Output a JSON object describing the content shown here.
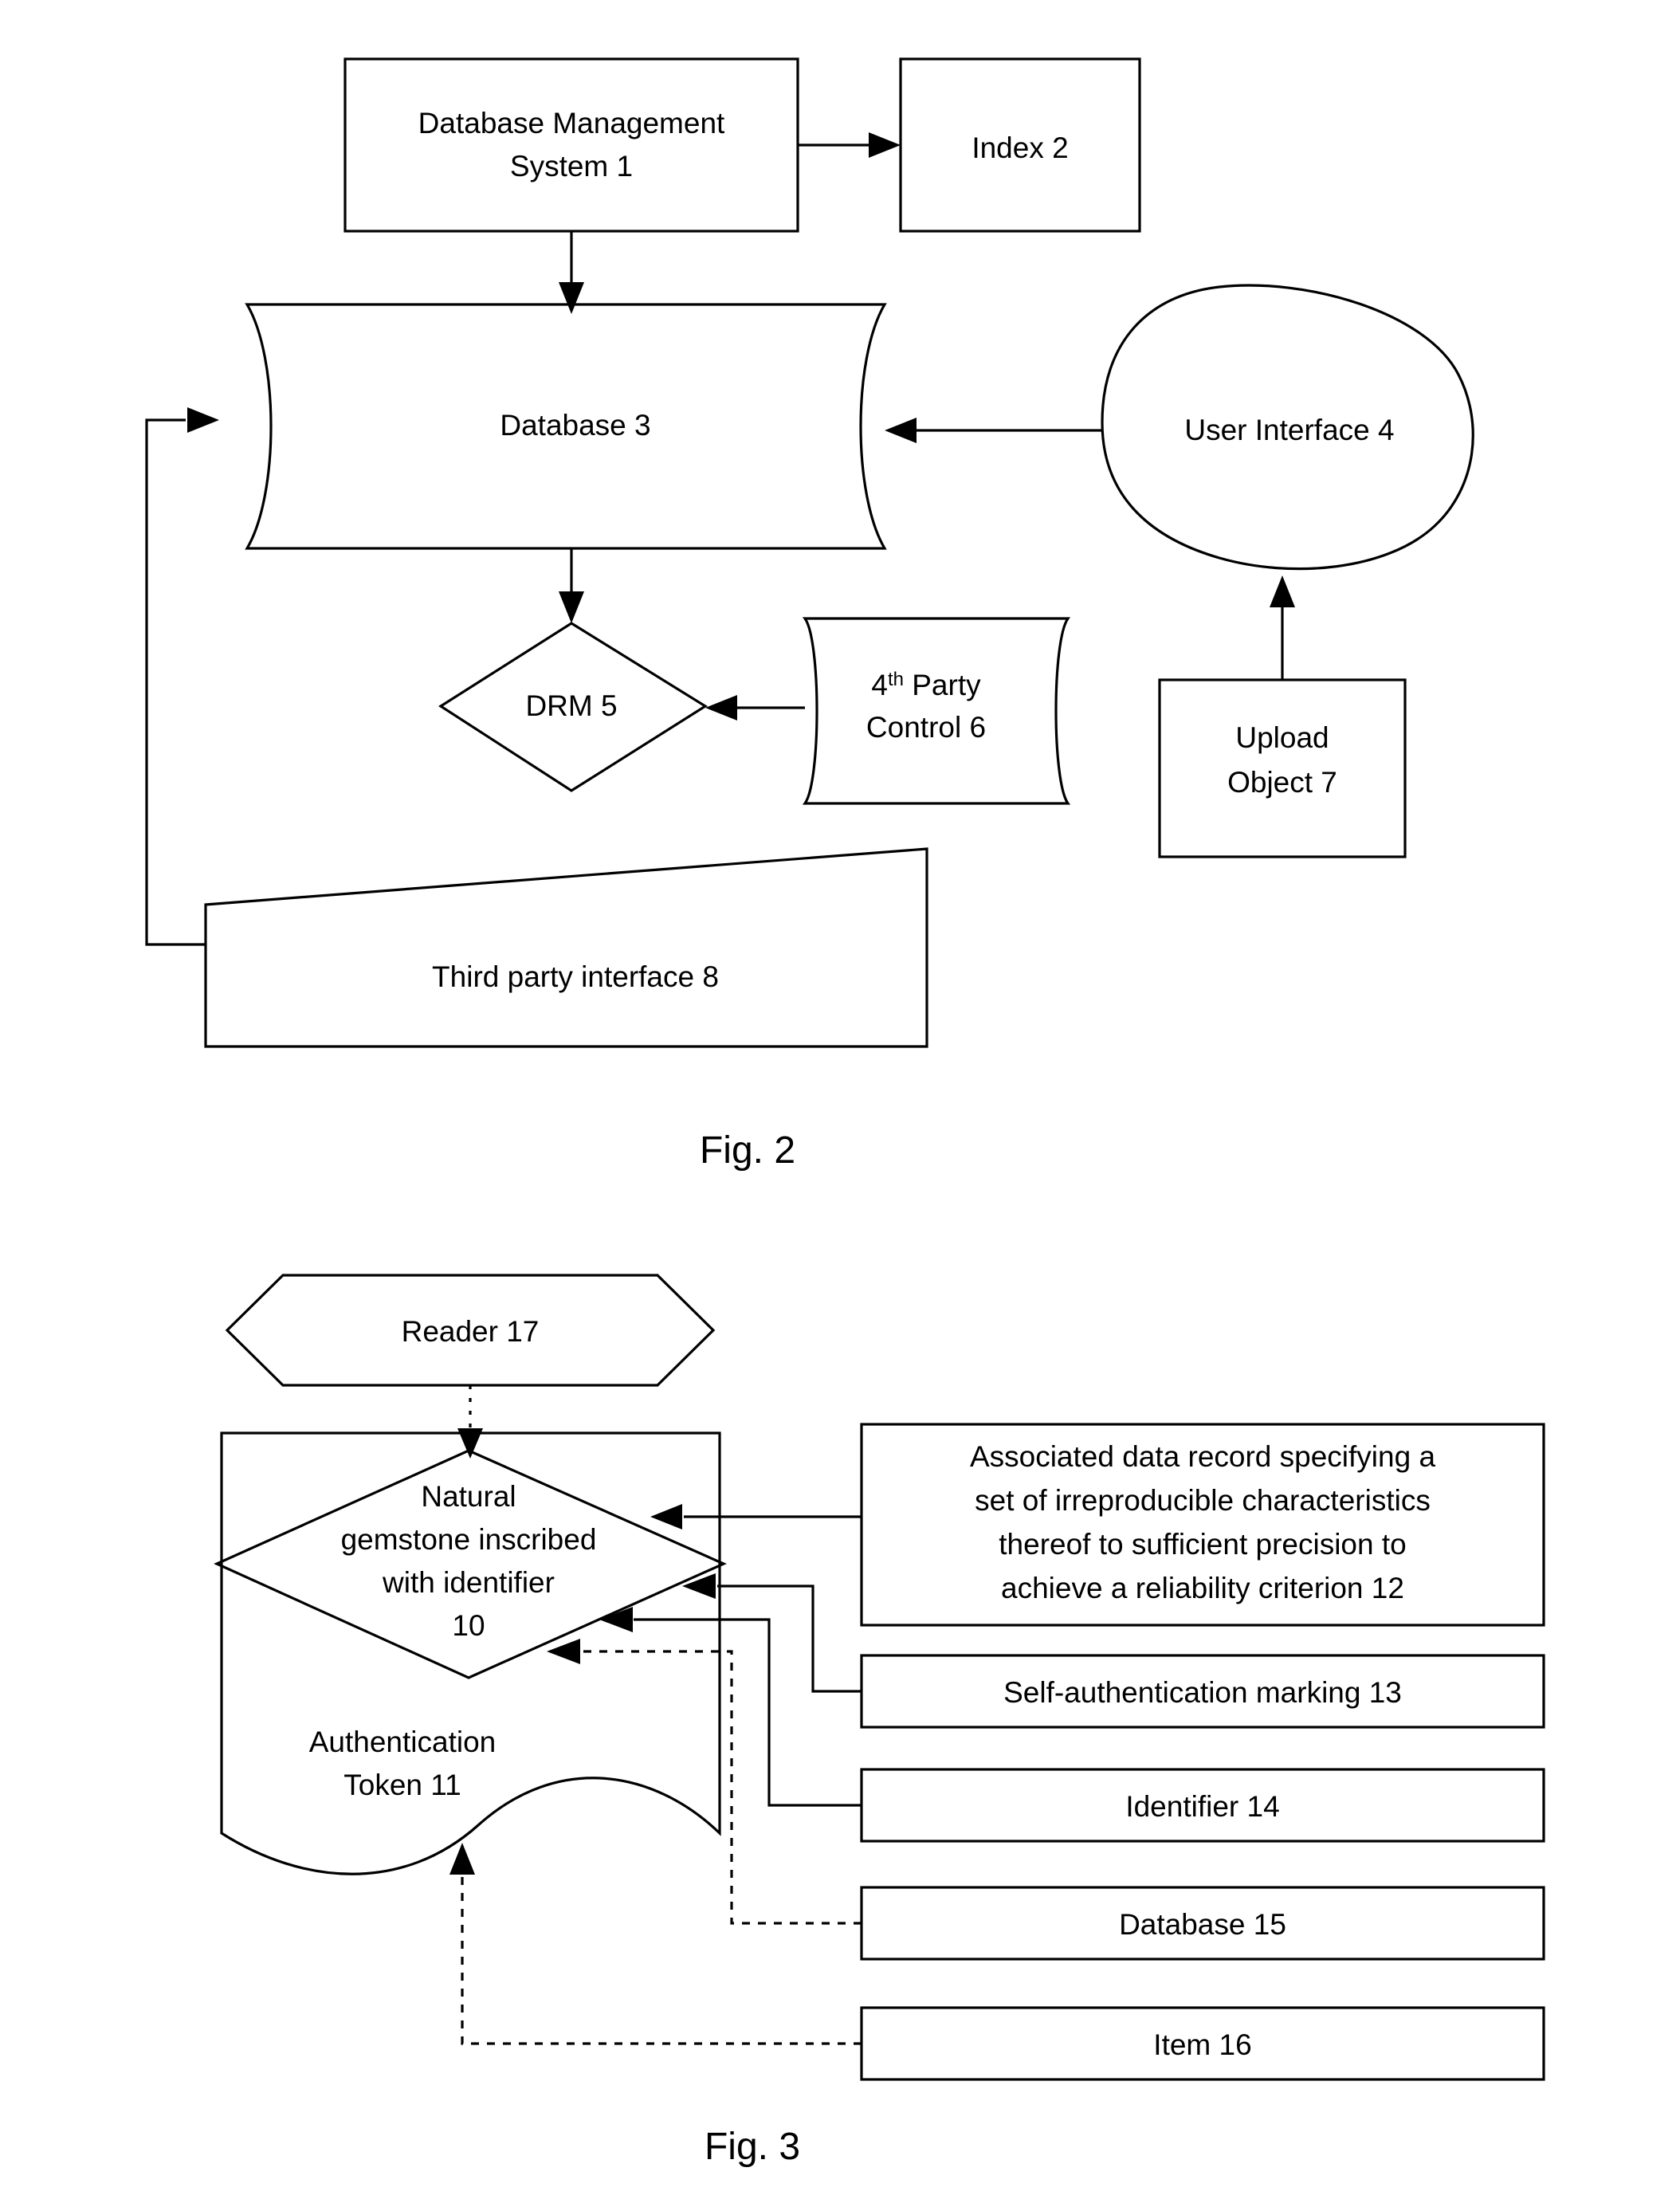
{
  "figures": [
    {
      "id": "fig2",
      "caption": "Fig. 2",
      "nodes": {
        "dbms": "Database Management System 1",
        "index": "Index 2",
        "database": "Database 3",
        "user_interface": "User Interface 4",
        "drm": "DRM 5",
        "fourth_party_line1": "4",
        "fourth_party_sup": "th",
        "fourth_party_line1b": " Party",
        "fourth_party_line2": "Control 6",
        "upload_object_line1": "Upload",
        "upload_object_line2": "Object 7",
        "third_party_interface": "Third party interface 8"
      }
    },
    {
      "id": "fig3",
      "caption": "Fig. 3",
      "nodes": {
        "reader": "Reader 17",
        "gemstone_line1": "Natural",
        "gemstone_line2": "gemstone inscribed",
        "gemstone_line3": "with identifier",
        "gemstone_line4": "10",
        "auth_token_line1": "Authentication",
        "auth_token_line2": "Token 11",
        "assoc_record_line1": "Associated data record specifying a",
        "assoc_record_line2": "set of irreproducible characteristics",
        "assoc_record_line3": "thereof to sufficient precision to",
        "assoc_record_line4": "achieve a reliability criterion 12",
        "self_auth": "Self-authentication marking 13",
        "identifier": "Identifier 14",
        "database15": "Database 15",
        "item16": "Item 16"
      }
    }
  ]
}
